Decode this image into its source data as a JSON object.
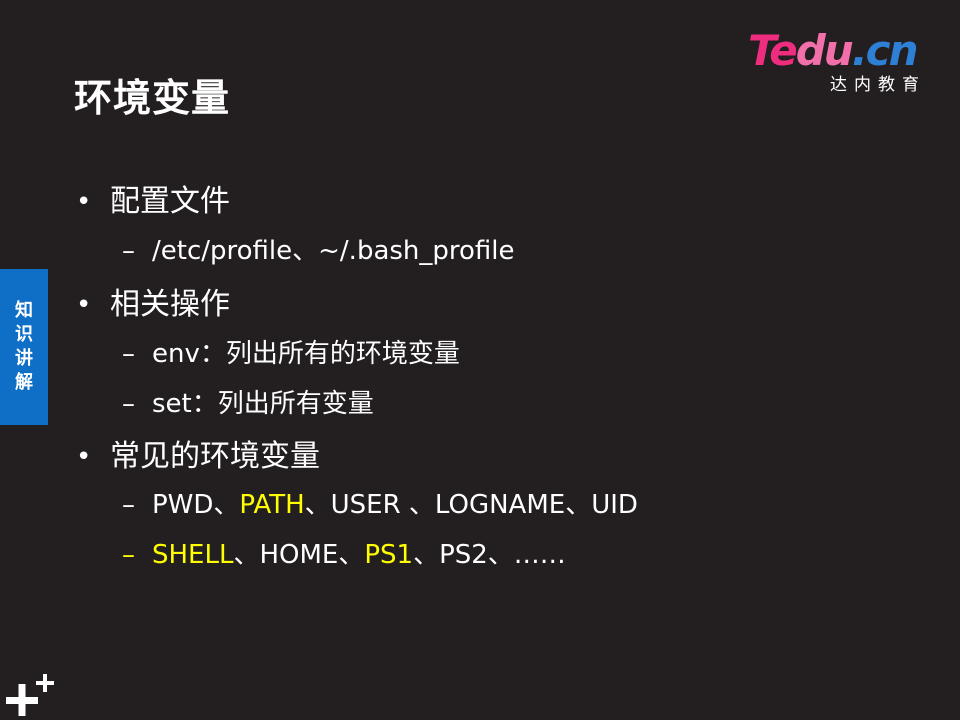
{
  "title": "环境变量",
  "logo": {
    "word_te": "Te",
    "word_du": "du",
    "word_dot": ".",
    "word_cn": "cn",
    "subtitle": "达内教育"
  },
  "side_tab": {
    "label": "知识讲解"
  },
  "bullets": [
    {
      "label": "配置文件",
      "subs": [
        {
          "parts": [
            {
              "text": "/etc/profile、~/.bash_profile",
              "highlight": false
            }
          ]
        }
      ]
    },
    {
      "label": "相关操作",
      "subs": [
        {
          "parts": [
            {
              "text": "env：列出所有的环境变量",
              "highlight": false
            }
          ]
        },
        {
          "parts": [
            {
              "text": "set：列出所有变量",
              "highlight": false
            }
          ]
        }
      ]
    },
    {
      "label": "常见的环境变量",
      "subs": [
        {
          "parts": [
            {
              "text": "PWD、",
              "highlight": false
            },
            {
              "text": "PATH",
              "highlight": true
            },
            {
              "text": "、USER 、LOGNAME、UID",
              "highlight": false
            }
          ]
        },
        {
          "dash_highlight": true,
          "parts": [
            {
              "text": "SHELL",
              "highlight": true
            },
            {
              "text": "、HOME、",
              "highlight": false
            },
            {
              "text": "PS1",
              "highlight": true
            },
            {
              "text": "、PS2、……",
              "highlight": false
            }
          ]
        }
      ]
    }
  ],
  "colors": {
    "background": "#231f20",
    "highlight": "#ffff00",
    "side_tab": "#0f6fc6",
    "logo_magenta": "#ee2d7e",
    "logo_blue": "#2e7fd6"
  },
  "icons": {
    "corner_logo": "plus-plus-logo-icon",
    "bullet": "bullet-dot-icon",
    "dash": "en-dash-icon"
  }
}
